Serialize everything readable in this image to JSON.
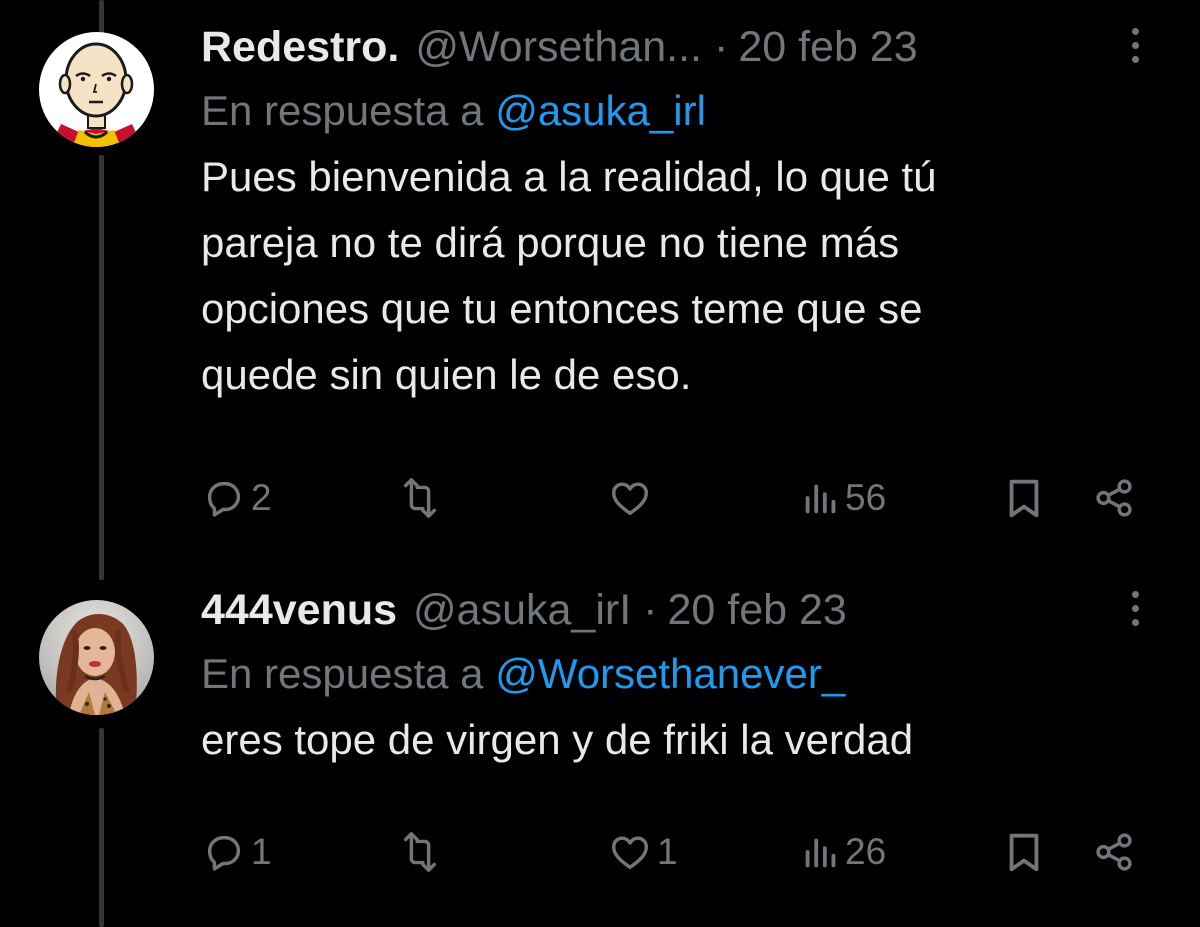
{
  "colors": {
    "background": "#000000",
    "text_primary": "#e7e9ea",
    "text_secondary": "#71767b",
    "link": "#1d9bf0",
    "thread_line": "#333639"
  },
  "tweets": [
    {
      "avatar_icon": "bald-hero-avatar",
      "name": "Redestro.",
      "handle": "@Worsethan...",
      "separator": "·",
      "date": "20 feb 23",
      "reply_prefix": "En respuesta a ",
      "reply_mention": "@asuka_irl",
      "text": "Pues bienvenida a la realidad, lo que tú\npareja no te dirá porque no tiene más\nopciones que tu entonces teme que se\nquede sin quien le de eso.",
      "actions": {
        "reply_count": "2",
        "retweet_count": "",
        "like_count": "",
        "views_count": "56"
      }
    },
    {
      "avatar_icon": "profile-photo-avatar",
      "name": "444venus",
      "handle": "@asuka_irI",
      "separator": "·",
      "date": "20 feb 23",
      "reply_prefix": "En respuesta a ",
      "reply_mention": "@Worsethanever_",
      "text": "eres tope de virgen y de friki la verdad",
      "actions": {
        "reply_count": "1",
        "retweet_count": "",
        "like_count": "1",
        "views_count": "26"
      }
    }
  ]
}
